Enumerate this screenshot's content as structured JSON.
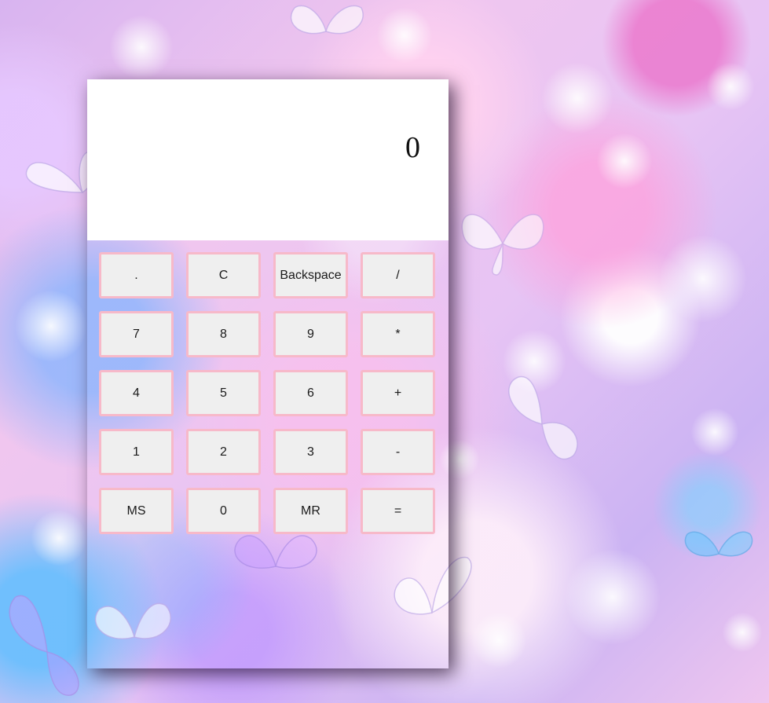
{
  "calculator": {
    "display_value": "0",
    "keys": [
      {
        "label": ".",
        "name": "decimal-key"
      },
      {
        "label": "C",
        "name": "clear-key"
      },
      {
        "label": "Backspace",
        "name": "backspace-key"
      },
      {
        "label": "/",
        "name": "divide-key"
      },
      {
        "label": "7",
        "name": "digit-7-key"
      },
      {
        "label": "8",
        "name": "digit-8-key"
      },
      {
        "label": "9",
        "name": "digit-9-key"
      },
      {
        "label": "*",
        "name": "multiply-key"
      },
      {
        "label": "4",
        "name": "digit-4-key"
      },
      {
        "label": "5",
        "name": "digit-5-key"
      },
      {
        "label": "6",
        "name": "digit-6-key"
      },
      {
        "label": "+",
        "name": "add-key"
      },
      {
        "label": "1",
        "name": "digit-1-key"
      },
      {
        "label": "2",
        "name": "digit-2-key"
      },
      {
        "label": "3",
        "name": "digit-3-key"
      },
      {
        "label": "-",
        "name": "subtract-key"
      },
      {
        "label": "MS",
        "name": "memory-store-key"
      },
      {
        "label": "0",
        "name": "digit-0-key"
      },
      {
        "label": "MR",
        "name": "memory-recall-key"
      },
      {
        "label": "=",
        "name": "equals-key"
      }
    ]
  },
  "theme": {
    "key_background": "#efefef",
    "key_border": "#f7b9c9",
    "display_background": "#ffffff",
    "background_icon": "butterfly-icon"
  }
}
